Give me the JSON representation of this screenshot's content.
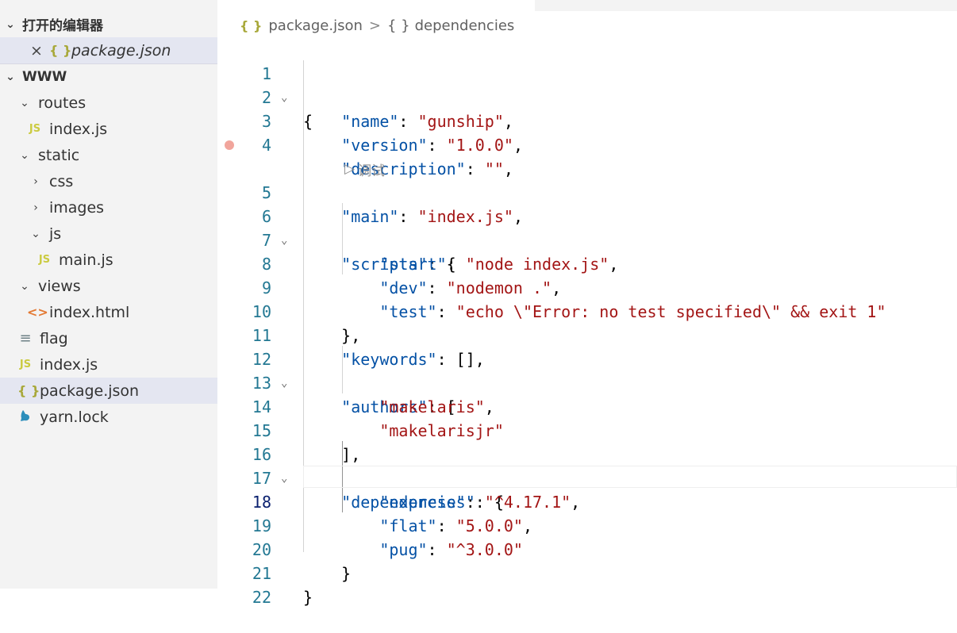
{
  "sidebar": {
    "open_editors": {
      "header": "打开的编辑器",
      "items": [
        {
          "name": "package.json",
          "icon": "json-braces-icon"
        }
      ]
    },
    "folder": {
      "header": "WWW",
      "tree": [
        {
          "label": "routes",
          "type": "folder",
          "expanded": true
        },
        {
          "label": "index.js",
          "type": "file-js"
        },
        {
          "label": "static",
          "type": "folder",
          "expanded": true
        },
        {
          "label": "css",
          "type": "folder",
          "expanded": false
        },
        {
          "label": "images",
          "type": "folder",
          "expanded": false
        },
        {
          "label": "js",
          "type": "folder",
          "expanded": true
        },
        {
          "label": "main.js",
          "type": "file-js"
        },
        {
          "label": "views",
          "type": "folder",
          "expanded": true
        },
        {
          "label": "index.html",
          "type": "file-html"
        },
        {
          "label": "flag",
          "type": "file-text"
        },
        {
          "label": "index.js",
          "type": "file-js"
        },
        {
          "label": "package.json",
          "type": "file-json",
          "selected": true
        },
        {
          "label": "yarn.lock",
          "type": "file-yarn"
        }
      ]
    },
    "icon_text": {
      "js": "JS",
      "json": "{ }",
      "html": "<>"
    }
  },
  "breadcrumb": {
    "file": "package.json",
    "symbol": "dependencies",
    "icon_text": "{ }",
    "separator": ">"
  },
  "editor": {
    "codelens_label": "调试",
    "current_line": 18,
    "breakpoint_line": 5,
    "lines": [
      {
        "n": "1",
        "fold": true
      },
      {
        "n": "2"
      },
      {
        "n": "3"
      },
      {
        "n": "4"
      },
      {
        "n": "5"
      },
      {
        "n": "6",
        "fold": true
      },
      {
        "n": "7"
      },
      {
        "n": "8"
      },
      {
        "n": "9"
      },
      {
        "n": "10"
      },
      {
        "n": "11"
      },
      {
        "n": "12",
        "fold": true
      },
      {
        "n": "13"
      },
      {
        "n": "14"
      },
      {
        "n": "15"
      },
      {
        "n": "16",
        "fold": true
      },
      {
        "n": "17"
      },
      {
        "n": "18"
      },
      {
        "n": "19"
      },
      {
        "n": "20"
      },
      {
        "n": "21"
      },
      {
        "n": "22"
      }
    ],
    "code": {
      "l1": "{",
      "l2_key": "\"name\"",
      "l2_val": "\"gunship\"",
      "l3_key": "\"version\"",
      "l3_val": "\"1.0.0\"",
      "l4_key": "\"description\"",
      "l4_val": "\"\"",
      "l5_key": "\"main\"",
      "l5_val": "\"index.js\"",
      "l6_key": "\"scripts\"",
      "l7_key": "\"start\"",
      "l7_val": "\"node index.js\"",
      "l8_key": "\"dev\"",
      "l8_val": "\"nodemon .\"",
      "l9_key": "\"test\"",
      "l9_val": "\"echo \\\"Error: no test specified\\\" && exit 1\"",
      "l10": "},",
      "l11_key": "\"keywords\"",
      "l11_rest": ": [],",
      "l12_key": "\"authors\"",
      "l12_rest": ": [",
      "l13_val": "\"makelaris\"",
      "l14_val": "\"makelarisjr\"",
      "l15": "],",
      "l16_key": "\"dependencies\"",
      "l16_rest": ": {",
      "l17_key": "\"express\"",
      "l17_val": "\"^4.17.1\"",
      "l18_key": "\"flat\"",
      "l18_val": "\"5.0.0\"",
      "l19_key": "\"pug\"",
      "l19_val": "\"^3.0.0\"",
      "l20": "}",
      "l21": "}"
    }
  },
  "colors": {
    "key": "#0451a5",
    "string": "#a31515",
    "line_number": "#237893",
    "sidebar_bg": "#f3f3f3",
    "selection_bg": "#e4e6f1",
    "breakpoint": "#f1a59c"
  }
}
